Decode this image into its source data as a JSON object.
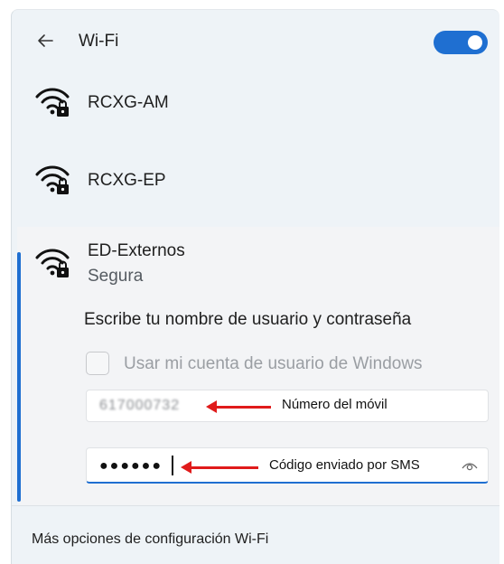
{
  "header": {
    "back_icon": "back-arrow-icon",
    "title": "Wi-Fi",
    "toggle_state": "on",
    "accent_color": "#1f6fd1"
  },
  "networks": [
    {
      "name": "RCXG-AM",
      "icon": "wifi-secured-icon"
    },
    {
      "name": "RCXG-EP",
      "icon": "wifi-secured-icon"
    }
  ],
  "expanded_network": {
    "name": "ED-Externos",
    "status": "Segura",
    "icon": "wifi-secured-icon",
    "prompt": "Escribe tu nombre de usuario y contraseña",
    "use_windows_account_label": "Usar mi cuenta de usuario de Windows",
    "use_windows_account_checked": false,
    "username_value": "617000732",
    "password_value": "●●●●●●",
    "annotations": {
      "username": "Número del móvil",
      "password": "Código enviado por SMS"
    },
    "annotation_color": "#e01b1b"
  },
  "footer": {
    "link_label": "Más opciones de configuración Wi-Fi"
  }
}
